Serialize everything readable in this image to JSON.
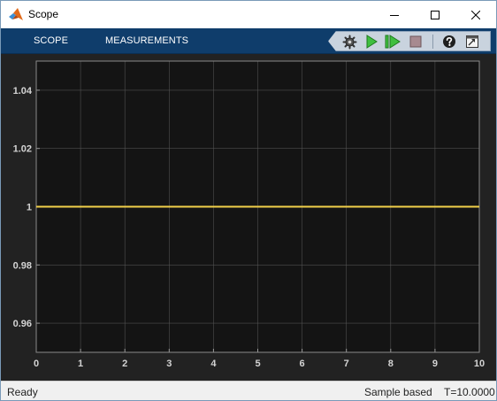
{
  "window": {
    "title": "Scope"
  },
  "toolstrip": {
    "tabs": [
      {
        "label": "SCOPE"
      },
      {
        "label": "MEASUREMENTS"
      }
    ],
    "tools": [
      {
        "name": "settings-gear-icon"
      },
      {
        "name": "run-icon"
      },
      {
        "name": "step-forward-icon"
      },
      {
        "name": "stop-icon"
      },
      {
        "name": "help-icon"
      },
      {
        "name": "undock-icon"
      }
    ]
  },
  "colors": {
    "toolstrip": "#0f3d6b",
    "plot_background": "#141414",
    "figure_background": "#222222",
    "grid": "#555555",
    "signal": "#f2d14a",
    "tick_labels": "#d4d4d4"
  },
  "chart_data": {
    "type": "line",
    "grid": true,
    "xlim": [
      0,
      10
    ],
    "ylim": [
      0.95,
      1.05
    ],
    "xticks": [
      0,
      1,
      2,
      3,
      4,
      5,
      6,
      7,
      8,
      9,
      10
    ],
    "xtick_labels": [
      "0",
      "1",
      "2",
      "3",
      "4",
      "5",
      "6",
      "7",
      "8",
      "9",
      "10"
    ],
    "yticks": [
      0.96,
      0.98,
      1,
      1.02,
      1.04
    ],
    "ytick_labels": [
      "0.96",
      "0.98",
      "1",
      "1.02",
      "1.04"
    ],
    "series": [
      {
        "x": [
          0,
          10
        ],
        "y": [
          1,
          1
        ],
        "color": "#f2d14a"
      }
    ]
  },
  "status": {
    "ready": "Ready",
    "mode": "Sample based",
    "time": "T=10.0000"
  }
}
